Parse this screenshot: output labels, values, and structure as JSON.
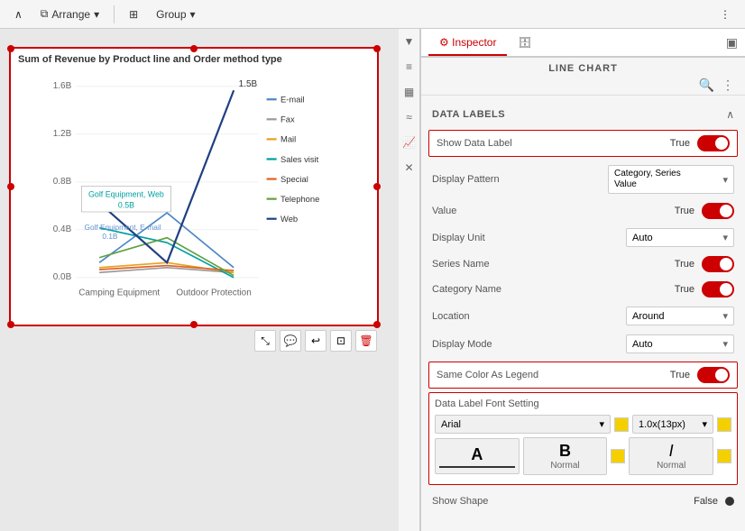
{
  "toolbar": {
    "arrange_label": "Arrange",
    "group_label": "Group",
    "more_icon": "⋮"
  },
  "inspector": {
    "tab_label": "Inspector",
    "tab_icon": "⚙",
    "db_icon": "🗄",
    "panel_icon": "▣",
    "section_title": "LINE CHART",
    "search_icon": "🔍",
    "more_icon": "⋮",
    "data_labels_title": "DATA LABELS",
    "show_data_label": "Show Data Label",
    "show_data_label_value": "True",
    "display_pattern": "Display Pattern",
    "display_pattern_value": "Category, Series\nValue",
    "value_label": "Value",
    "value_value": "True",
    "display_unit": "Display Unit",
    "display_unit_value": "Auto",
    "series_name": "Series Name",
    "series_name_value": "True",
    "category_name": "Category Name",
    "category_name_value": "True",
    "location": "Location",
    "location_value": "Around",
    "display_mode": "Display Mode",
    "display_mode_value": "Auto",
    "same_color_as_legend": "Same Color As Legend",
    "same_color_as_legend_value": "True",
    "font_setting_title": "Data Label Font Setting",
    "font_name": "Arial",
    "font_size": "1.0x(13px)",
    "font_bold_label": "A",
    "font_bold_sublabel": "",
    "font_italic_label": "B",
    "font_italic_sublabel": "Normal",
    "font_italic2_label": "I",
    "font_italic2_sublabel": "Normal",
    "show_shape": "Show Shape",
    "show_shape_value": "False"
  },
  "chart": {
    "title": "Sum of Revenue by Product line and Order method type",
    "y_labels": [
      "1.6B",
      "1.2B",
      "0.8B",
      "0.4B",
      "0.0B"
    ],
    "x_labels": [
      "Camping Equipment",
      "Outdoor Protection"
    ],
    "legend": [
      "E-mail",
      "Fax",
      "Mail",
      "Sales visit",
      "Special",
      "Telephone",
      "Web"
    ],
    "annotation1": "Golf Equipment, Web\n0.5B",
    "annotation2": "Golf Equipment, E-mail\n0.1B",
    "peak_label": "1.5B"
  },
  "side_icons": [
    "▼",
    "≡",
    "▦",
    "≈",
    "≈",
    "✕"
  ]
}
